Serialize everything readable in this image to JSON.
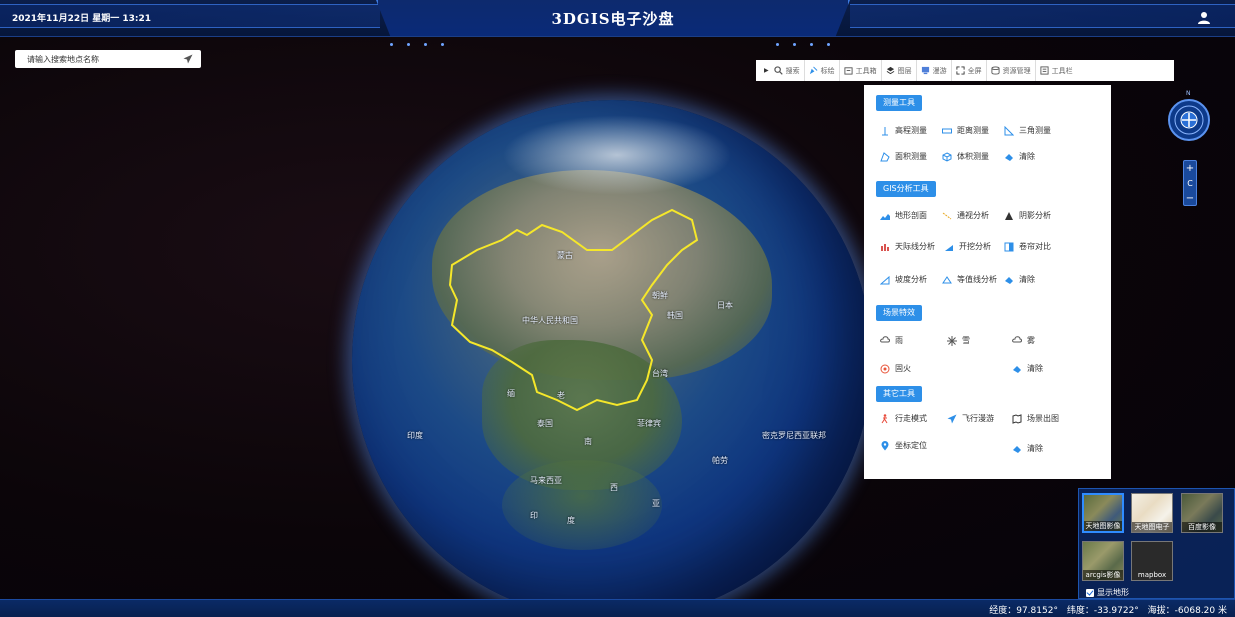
{
  "header": {
    "datetime": "2021年11月22日 星期一 13:21",
    "title": "3DGIS电子沙盘",
    "user_icon": "user-icon"
  },
  "search": {
    "placeholder": "请输入搜索地点名称",
    "icon": "send-icon"
  },
  "globe": {
    "labels": [
      "中华人民共和国",
      "蒙古",
      "朝鲜",
      "韩国",
      "日本",
      "泰国",
      "马来西亚",
      "菲律宾",
      "帕劳",
      "印",
      "度",
      "西",
      "亚",
      "南",
      "缅",
      "印度",
      "老",
      "台湾",
      "密克罗尼西亚联邦"
    ]
  },
  "toolbar": {
    "items": [
      {
        "label": "搜索",
        "icon": "search-icon"
      },
      {
        "label": "标绘",
        "icon": "draw-icon"
      },
      {
        "label": "工具箱",
        "icon": "toolbox-icon"
      },
      {
        "label": "图层",
        "icon": "layers-icon"
      },
      {
        "label": "漫游",
        "icon": "roam-icon"
      },
      {
        "label": "全屏",
        "icon": "fullscreen-icon"
      },
      {
        "label": "资源管理",
        "icon": "resource-icon"
      },
      {
        "label": "工具栏",
        "icon": "toolbar-icon"
      }
    ]
  },
  "panel": {
    "measure": {
      "title": "测量工具",
      "tools": [
        "高程测量",
        "距离测量",
        "三角测量",
        "面积测量",
        "体积测量",
        "清除"
      ]
    },
    "gis": {
      "title": "GIS分析工具",
      "tools": [
        "地形剖面",
        "通视分析",
        "阴影分析",
        "天际线分析",
        "开挖分析",
        "卷帘对比",
        "坡度分析",
        "等值线分析",
        "清除"
      ]
    },
    "effects": {
      "title": "场景特效",
      "tools": [
        "雨",
        "雪",
        "雾",
        "固火",
        "清除"
      ]
    },
    "other": {
      "title": "其它工具",
      "tools": [
        "行走模式",
        "飞行漫游",
        "场景出图",
        "坐标定位",
        "清除"
      ]
    }
  },
  "compass": {
    "north_label": "N"
  },
  "zoom": {
    "in": "+",
    "reset": "C",
    "out": "−"
  },
  "basemaps": {
    "items": [
      "天地图影像",
      "天地图电子",
      "百度影像",
      "arcgis影像",
      "mapbox"
    ],
    "selected": "天地图影像",
    "terrain_label": "显示地形",
    "terrain_checked": true
  },
  "status": {
    "longitude": "经度：97.8152°",
    "latitude": "纬度：-33.9722°",
    "altitude": "海拔：-6068.20 米"
  },
  "colors": {
    "accent": "#2d8fe8",
    "header": "#0b1e4b",
    "border_yellow": "#f5e72a"
  }
}
